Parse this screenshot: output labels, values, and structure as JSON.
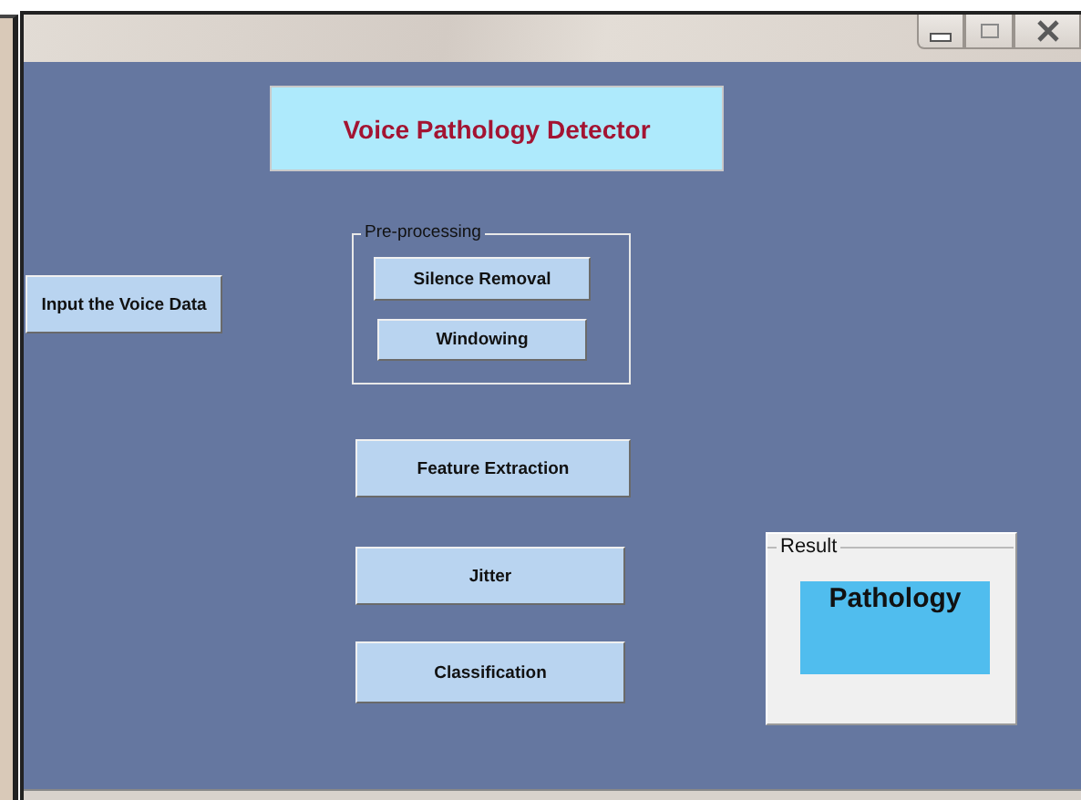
{
  "title": "Voice Pathology Detector",
  "input_button": "Input the Voice Data",
  "preprocessing": {
    "label": "Pre-processing",
    "buttons": [
      "Silence Removal",
      "Windowing"
    ]
  },
  "buttons": [
    "Feature Extraction",
    "Jitter",
    "Classification"
  ],
  "result": {
    "label": "Result",
    "value": "Pathology"
  }
}
